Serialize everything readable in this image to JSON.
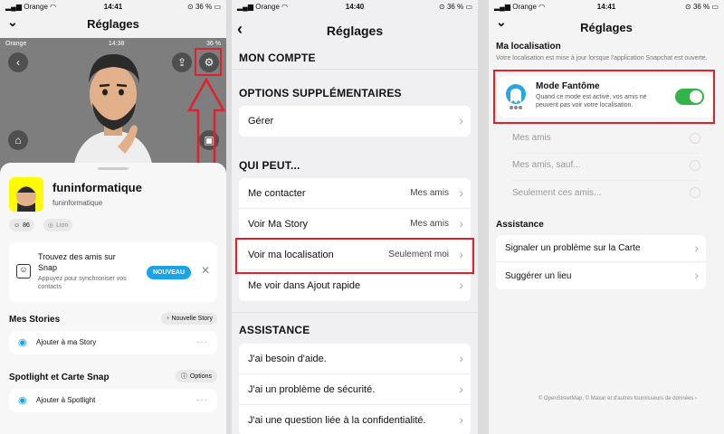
{
  "p1": {
    "status": {
      "carrier": "Orange",
      "time": "14:41",
      "battery": "36 %"
    },
    "title": "Réglages",
    "hero_status": {
      "carrier": "Orange",
      "time": "14:38",
      "battery": "36 %"
    },
    "name": "funinformatique",
    "username": "funinformatique",
    "score": "86",
    "zodiac": "Lion",
    "friends_card": {
      "title": "Trouvez des amis sur Snap",
      "subtitle": "Appuyez pour synchroniser vos contacts",
      "button": "NOUVEAU"
    },
    "stories_title": "Mes Stories",
    "new_story": "Nouvelle Story",
    "add_story": "Ajouter à ma Story",
    "spotlight_title": "Spotlight et Carte Snap",
    "options": "Options",
    "add_spotlight": "Ajouter à Spotlight"
  },
  "p2": {
    "status": {
      "carrier": "Orange",
      "time": "14:40",
      "battery": "36 %"
    },
    "title": "Réglages",
    "sec_account": "MON COMPTE",
    "sec_extra": "OPTIONS SUPPLÉMENTAIRES",
    "manage": "Gérer",
    "sec_who": "QUI PEUT...",
    "who_rows": [
      {
        "label": "Me contacter",
        "value": "Mes amis"
      },
      {
        "label": "Voir Ma Story",
        "value": "Mes amis"
      },
      {
        "label": "Voir ma localisation",
        "value": "Seulement moi"
      },
      {
        "label": "Me voir dans Ajout rapide",
        "value": ""
      }
    ],
    "sec_help": "ASSISTANCE",
    "help_rows": [
      {
        "label": "J'ai besoin d'aide."
      },
      {
        "label": "J'ai un problème de sécurité."
      },
      {
        "label": "J'ai une question liée à la confidentialité."
      }
    ]
  },
  "p3": {
    "status": {
      "carrier": "Orange",
      "time": "14:41",
      "battery": "36 %"
    },
    "title": "Réglages",
    "section": "Ma localisation",
    "desc": "Votre localisation est mise à jour lorsque l'application Snapchat est ouverte.",
    "ghost_title": "Mode Fantôme",
    "ghost_desc": "Quand ce mode est activé, vos amis ne peuvent pas voir votre localisation.",
    "ghost_on": true,
    "options": [
      "Mes amis",
      "Mes amis, sauf...",
      "Seulement ces amis..."
    ],
    "assist_title": "Assistance",
    "assist_rows": [
      "Signaler un problème sur la Carte",
      "Suggérer un lieu"
    ],
    "footer": "© OpenStreetMap, © Maxar et d'autres fournisseurs de données"
  },
  "colors": {
    "highlight": "#e0202a",
    "toggle": "#34b34a",
    "snap_yellow": "#fffc00",
    "button_blue": "#1aa3e8"
  }
}
